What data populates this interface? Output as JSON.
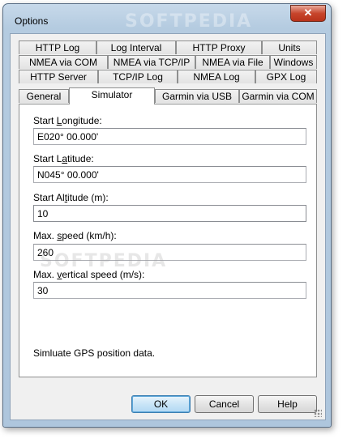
{
  "window": {
    "title": "Options",
    "close_glyph": "✕",
    "watermark": "SOFTPEDIA"
  },
  "tabs": {
    "row1": [
      "HTTP Log",
      "Log Interval",
      "HTTP Proxy",
      "Units"
    ],
    "row2": [
      "NMEA via COM",
      "NMEA via TCP/IP",
      "NMEA via File",
      "Windows"
    ],
    "row3": [
      "HTTP Server",
      "TCP/IP Log",
      "NMEA Log",
      "GPX Log"
    ],
    "row4": [
      "General",
      "Simulator",
      "Garmin via USB",
      "Garmin via COM"
    ],
    "active": "Simulator"
  },
  "fields": [
    {
      "label_pre": "Start ",
      "label_acc": "L",
      "label_post": "ongitude:",
      "value": "E020° 00.000'"
    },
    {
      "label_pre": "Start L",
      "label_acc": "a",
      "label_post": "titude:",
      "value": "N045° 00.000'"
    },
    {
      "label_pre": "Start Al",
      "label_acc": "t",
      "label_post": "itude (m):",
      "value": "10"
    },
    {
      "label_pre": "Max. ",
      "label_acc": "s",
      "label_post": "peed (km/h):",
      "value": "260"
    },
    {
      "label_pre": "Max. ",
      "label_acc": "v",
      "label_post": "ertical speed (m/s):",
      "value": "30"
    }
  ],
  "status_text": "Simluate GPS position data.",
  "buttons": {
    "ok": "OK",
    "cancel": "Cancel",
    "help": "Help"
  },
  "overlay_watermark": "SOFTPEDIA"
}
